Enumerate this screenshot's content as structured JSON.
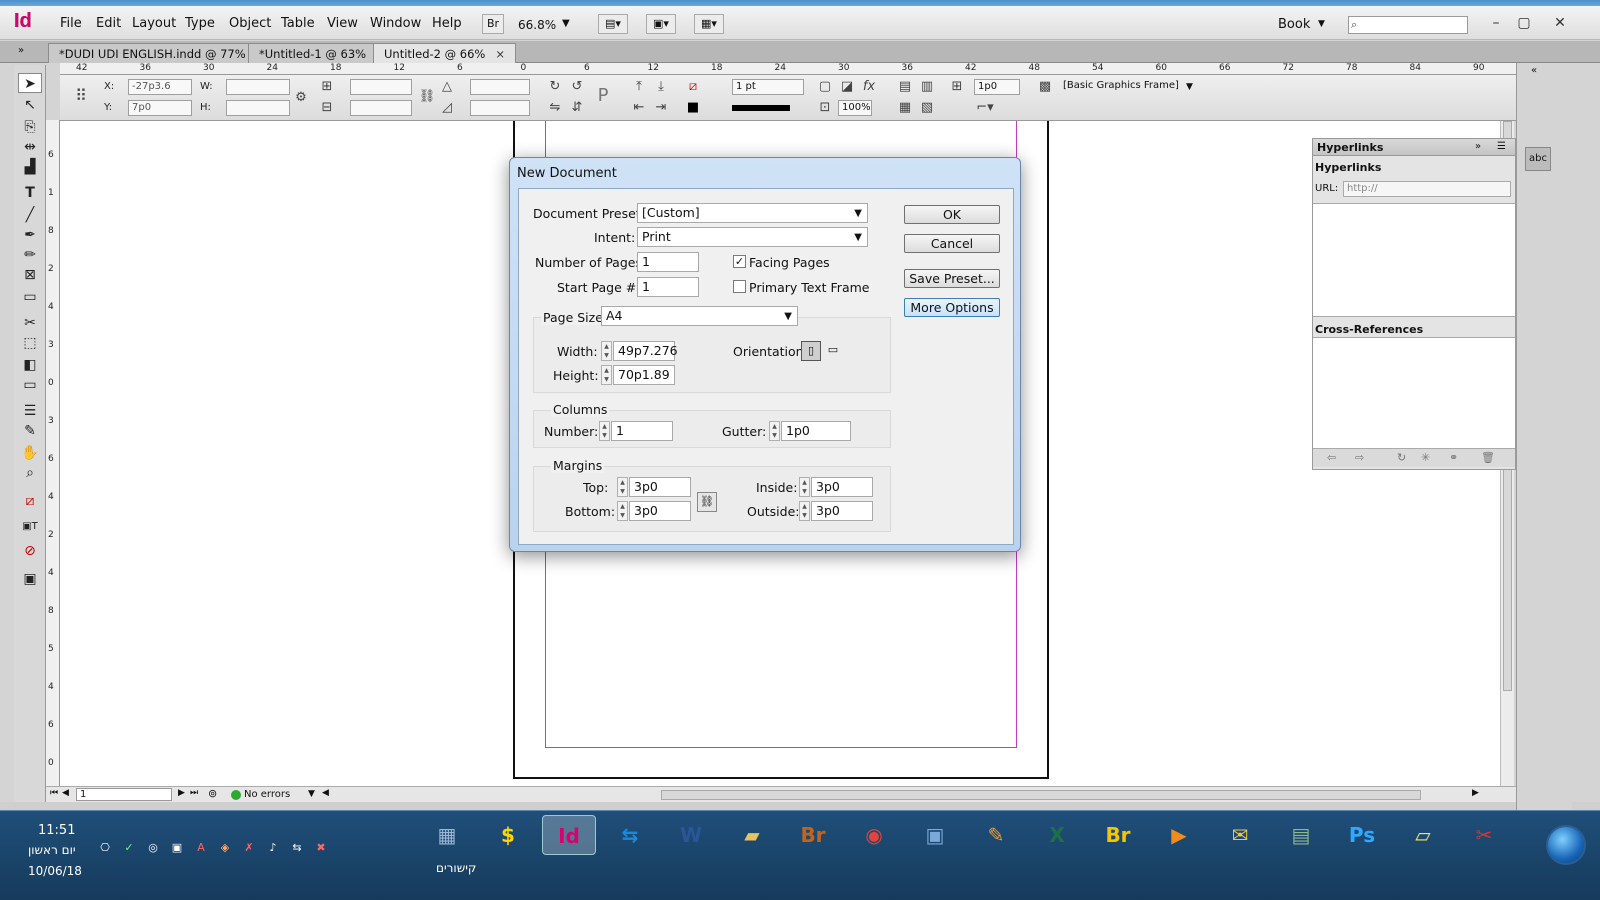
{
  "menubar": {
    "app_logo": "Id",
    "items": [
      "File",
      "Edit",
      "Layout",
      "Type",
      "Object",
      "Table",
      "View",
      "Window",
      "Help"
    ],
    "bridge_button": "Br",
    "zoom": "66.8%",
    "workspace": "Book"
  },
  "tabs": [
    {
      "label": "*DUDI UDI ENGLISH.indd @ 77%"
    },
    {
      "label": "*Untitled-1 @ 63%"
    },
    {
      "label": "Untitled-2 @ 66%"
    }
  ],
  "ruler": {
    "top_labels": [
      "42",
      "36",
      "30",
      "24",
      "18",
      "12",
      "6",
      "0",
      "6",
      "12",
      "18",
      "24",
      "30",
      "36",
      "42",
      "48",
      "54",
      "60",
      "66",
      "72",
      "78",
      "84",
      "90"
    ],
    "side_labels": [
      "6",
      "1",
      "8",
      "2",
      "4",
      "3",
      "0",
      "3",
      "6",
      "4",
      "2",
      "4",
      "8",
      "5",
      "4",
      "6",
      "0"
    ]
  },
  "control_panel": {
    "x_label": "X:",
    "x_value": "-27p3.6",
    "y_label": "Y:",
    "y_value": "7p0",
    "w_label": "W:",
    "h_label": "H:",
    "stroke_weight": "1 pt",
    "opacity": "100%",
    "offset": "1p0",
    "object_style": "[Basic Graphics Frame]"
  },
  "dialog": {
    "title": "New Document",
    "preset_label": "Document Preset:",
    "preset_value": "[Custom]",
    "intent_label": "Intent:",
    "intent_value": "Print",
    "pages_label": "Number of Pages:",
    "pages_value": "1",
    "start_label": "Start Page #:",
    "start_value": "1",
    "facing_label": "Facing Pages",
    "facing_checked": true,
    "primary_label": "Primary Text Frame",
    "primary_checked": false,
    "size_label": "Page Size:",
    "size_value": "A4",
    "width_label": "Width:",
    "width_value": "49p7.276",
    "height_label": "Height:",
    "height_value": "70p1.89",
    "orientation_label": "Orientation:",
    "columns_heading": "Columns",
    "number_label": "Number:",
    "number_value": "1",
    "gutter_label": "Gutter:",
    "gutter_value": "1p0",
    "margins_heading": "Margins",
    "top_label": "Top:",
    "top_value": "3p0",
    "bottom_label": "Bottom:",
    "bottom_value": "3p0",
    "inside_label": "Inside:",
    "inside_value": "3p0",
    "outside_label": "Outside:",
    "outside_value": "3p0",
    "ok": "OK",
    "cancel": "Cancel",
    "save_preset": "Save Preset...",
    "more_options": "More Options"
  },
  "hyperlinks_panel": {
    "tab": "Hyperlinks",
    "heading": "Hyperlinks",
    "url_label": "URL:",
    "url_placeholder": "http://",
    "cross_refs": "Cross-References"
  },
  "status": {
    "page": "1",
    "preflight": "No errors"
  },
  "taskbar": {
    "time": "11:51",
    "day": "יום ראשון",
    "date": "10/06/18",
    "quick_launch": "קישורים",
    "apps": [
      {
        "name": "calculator",
        "glyph": "▦",
        "color": "#9bb7d6"
      },
      {
        "name": "money",
        "glyph": "$",
        "color": "#ffd500"
      },
      {
        "name": "indesign",
        "glyph": "Id",
        "color": "#d6036f"
      },
      {
        "name": "teamviewer",
        "glyph": "⇆",
        "color": "#1a8ad6"
      },
      {
        "name": "word",
        "glyph": "W",
        "color": "#2a5699"
      },
      {
        "name": "folders",
        "glyph": "▰",
        "color": "#e8c25a"
      },
      {
        "name": "bridge",
        "glyph": "Br",
        "color": "#c4631c"
      },
      {
        "name": "chrome",
        "glyph": "◉",
        "color": "#e0443b"
      },
      {
        "name": "network",
        "glyph": "▣",
        "color": "#7aa9d9"
      },
      {
        "name": "paint",
        "glyph": "✎",
        "color": "#e8a23a"
      },
      {
        "name": "excel",
        "glyph": "X",
        "color": "#1e7145"
      },
      {
        "name": "bridge2",
        "glyph": "Br",
        "color": "#f5c500"
      },
      {
        "name": "media",
        "glyph": "▶",
        "color": "#f28b1a"
      },
      {
        "name": "outlook",
        "glyph": "✉",
        "color": "#f4c542"
      },
      {
        "name": "window",
        "glyph": "▤",
        "color": "#8fb98b"
      },
      {
        "name": "photoshop",
        "glyph": "Ps",
        "color": "#31a8ff"
      },
      {
        "name": "notes",
        "glyph": "▱",
        "color": "#f7e36b"
      },
      {
        "name": "tool",
        "glyph": "✂",
        "color": "#d33"
      }
    ]
  }
}
